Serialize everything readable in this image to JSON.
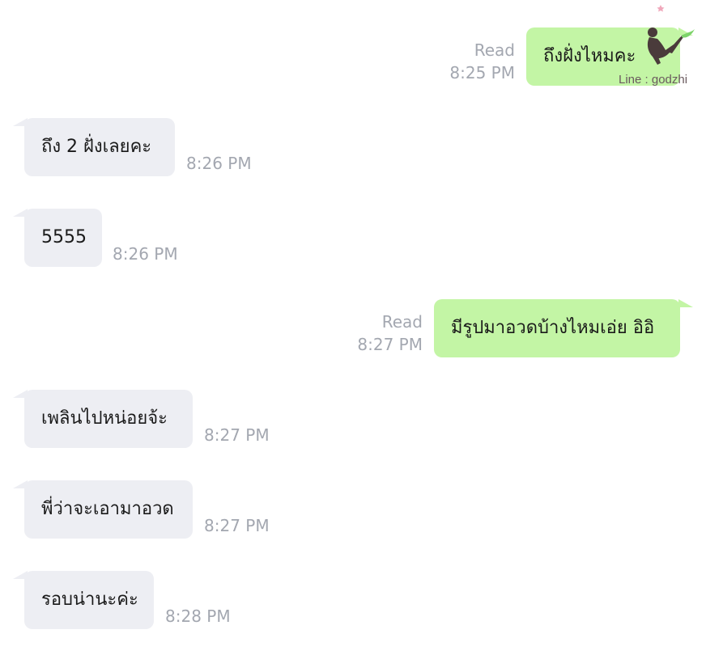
{
  "messages": [
    {
      "direction": "out",
      "text": "ถึงฝั่งไหมคะ",
      "status": "Read",
      "time": "8:25 PM"
    },
    {
      "direction": "in",
      "text": "ถึง 2 ฝั่งเลยคะ",
      "time": "8:26 PM"
    },
    {
      "direction": "in",
      "text": "5555",
      "time": "8:26 PM"
    },
    {
      "direction": "out",
      "text": "มีรูปมาอวดบ้างไหมเอ่ย อิอิ",
      "status": "Read",
      "time": "8:27 PM"
    },
    {
      "direction": "in",
      "text": "เพลินไปหน่อยจ้ะ",
      "time": "8:27 PM"
    },
    {
      "direction": "in",
      "text": "พี่ว่าจะเอามาอวด",
      "time": "8:27 PM"
    },
    {
      "direction": "in",
      "text": "รอบน่านะค่ะ",
      "time": "8:28 PM"
    }
  ],
  "watermark": {
    "text": "Line : godzhi"
  },
  "colors": {
    "incoming_bubble": "#edeef3",
    "outgoing_bubble": "#c3f5a5",
    "meta_text": "#a3a7b0"
  }
}
